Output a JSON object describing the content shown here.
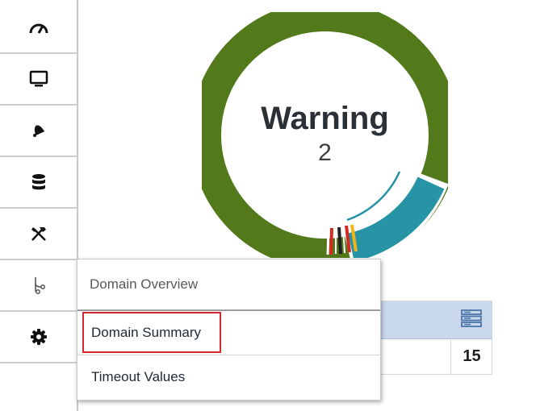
{
  "sidebar": {
    "items": [
      {
        "icon": "gauge-icon"
      },
      {
        "icon": "monitor-icon"
      },
      {
        "icon": "bell-icon"
      },
      {
        "icon": "database-icon"
      },
      {
        "icon": "tools-icon"
      },
      {
        "icon": "hierarchy-icon"
      },
      {
        "icon": "gear-icon"
      }
    ]
  },
  "status_gauge": {
    "title": "Warning",
    "value": "2",
    "colors": {
      "ok": "#527a1a",
      "info": "#2794a6",
      "critical": "#d42a1f",
      "warning": "#f2b51c"
    }
  },
  "summary_card": {
    "icon": "server-stack-icon",
    "value": "15",
    "header_color": "#c9d8ec"
  },
  "domain_menu": {
    "header": "Domain Overview",
    "items": [
      "Domain Summary",
      "Timeout Values"
    ],
    "selected": "Domain Summary"
  }
}
